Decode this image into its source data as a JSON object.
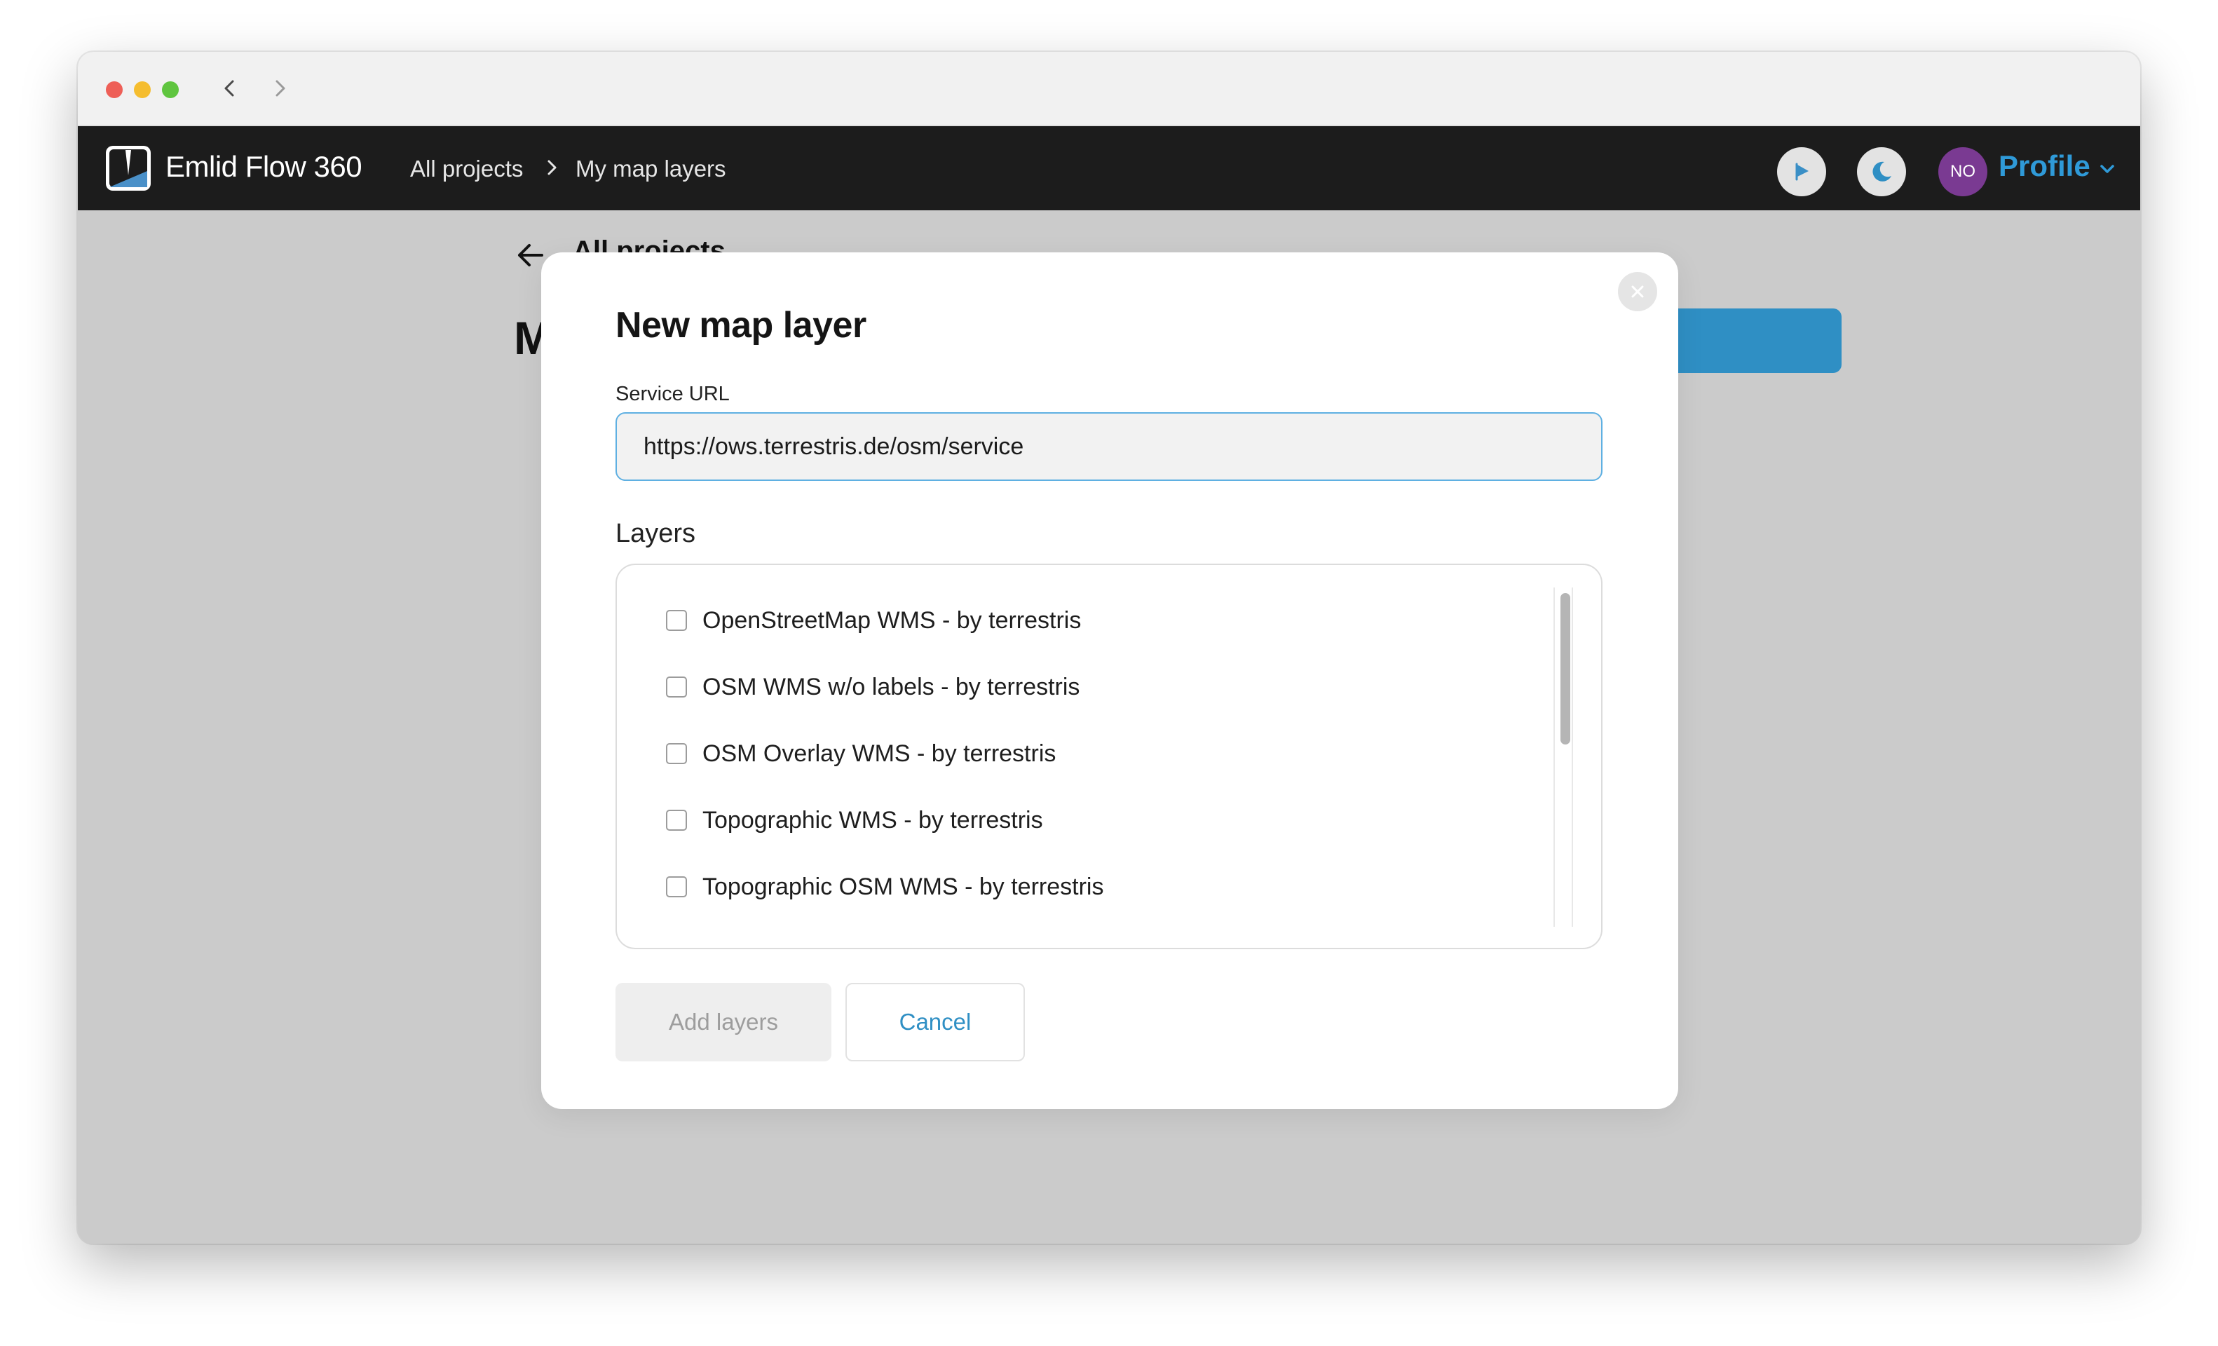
{
  "browser": {
    "back_icon": "chevron-left-icon",
    "forward_icon": "chevron-right-icon"
  },
  "header": {
    "app_title": "Emlid Flow 360",
    "breadcrumb": [
      "All projects",
      "My map layers"
    ],
    "profile_initials": "NO",
    "profile_label": "Profile",
    "accent_color": "#2f9ad8"
  },
  "background_page": {
    "back_link": "All projects",
    "heading_initial": "M"
  },
  "modal": {
    "title": "New map layer",
    "service_url_label": "Service URL",
    "service_url_value": "https://ows.terrestris.de/osm/service",
    "layers_label": "Layers",
    "layers": [
      "OpenStreetMap WMS - by terrestris",
      "OSM WMS w/o labels - by terrestris",
      "OSM Overlay WMS - by terrestris",
      "Topographic WMS - by terrestris",
      "Topographic OSM WMS - by terrestris"
    ],
    "add_button": "Add layers",
    "cancel_button": "Cancel"
  }
}
